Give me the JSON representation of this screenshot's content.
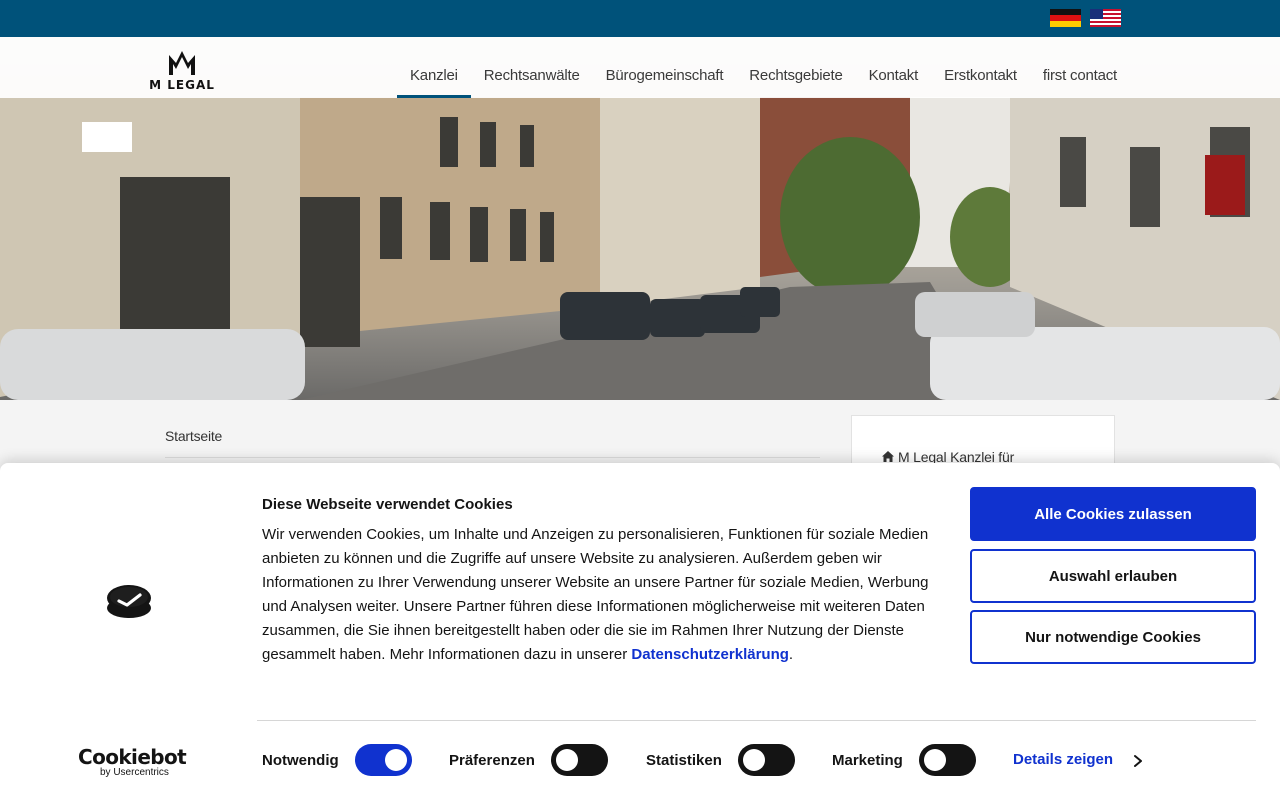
{
  "topbar": {
    "flags": [
      {
        "icon": "german-flag-icon",
        "lang": "de"
      },
      {
        "icon": "us-flag-icon",
        "lang": "en"
      }
    ]
  },
  "header": {
    "logo_text": "M LEGAL",
    "nav": [
      {
        "label": "Kanzlei",
        "active": true
      },
      {
        "label": "Rechtsanwälte",
        "active": false
      },
      {
        "label": "Bürogemeinschaft",
        "active": false
      },
      {
        "label": "Rechtsgebiete",
        "active": false
      },
      {
        "label": "Kontakt",
        "active": false
      },
      {
        "label": "Erstkontakt",
        "active": false
      },
      {
        "label": "first contact",
        "active": false
      }
    ],
    "accent_color": "#00527a"
  },
  "hero": {
    "icon": "street-photo-image"
  },
  "breadcrumb": {
    "current": "Startseite"
  },
  "sidebar": {
    "link_label": "M Legal Kanzlei für",
    "icon": "home-icon"
  },
  "cookie_banner": {
    "title": "Diese Webseite verwendet Cookies",
    "text": "Wir verwenden Cookies, um Inhalte und Anzeigen zu personalisieren, Funktionen für soziale Medien anbieten zu können und die Zugriffe auf unsere Website zu analysieren. Außerdem geben wir Informationen zu Ihrer Verwendung unserer Website an unsere Partner für soziale Medien, Werbung und Analysen weiter. Unsere Partner führen diese Informationen möglicherweise mit weiteren Daten zusammen, die Sie ihnen bereitgestellt haben oder die sie im Rahmen Ihrer Nutzung der Dienste gesammelt haben. Mehr Informationen dazu in unserer",
    "link_label": "Datenschutzerklärung",
    "link_suffix": ".",
    "buttons": {
      "allow_all": "Alle Cookies zulassen",
      "allow_selection": "Auswahl erlauben",
      "necessary_only": "Nur notwendige Cookies"
    },
    "toggles": [
      {
        "label": "Notwendig",
        "on": true
      },
      {
        "label": "Präferenzen",
        "on": false
      },
      {
        "label": "Statistiken",
        "on": false
      },
      {
        "label": "Marketing",
        "on": false
      }
    ],
    "details_label": "Details zeigen",
    "brand": {
      "name": "Cookiebot",
      "sub": "by Usercentrics"
    },
    "accent_color": "#1032cf"
  }
}
